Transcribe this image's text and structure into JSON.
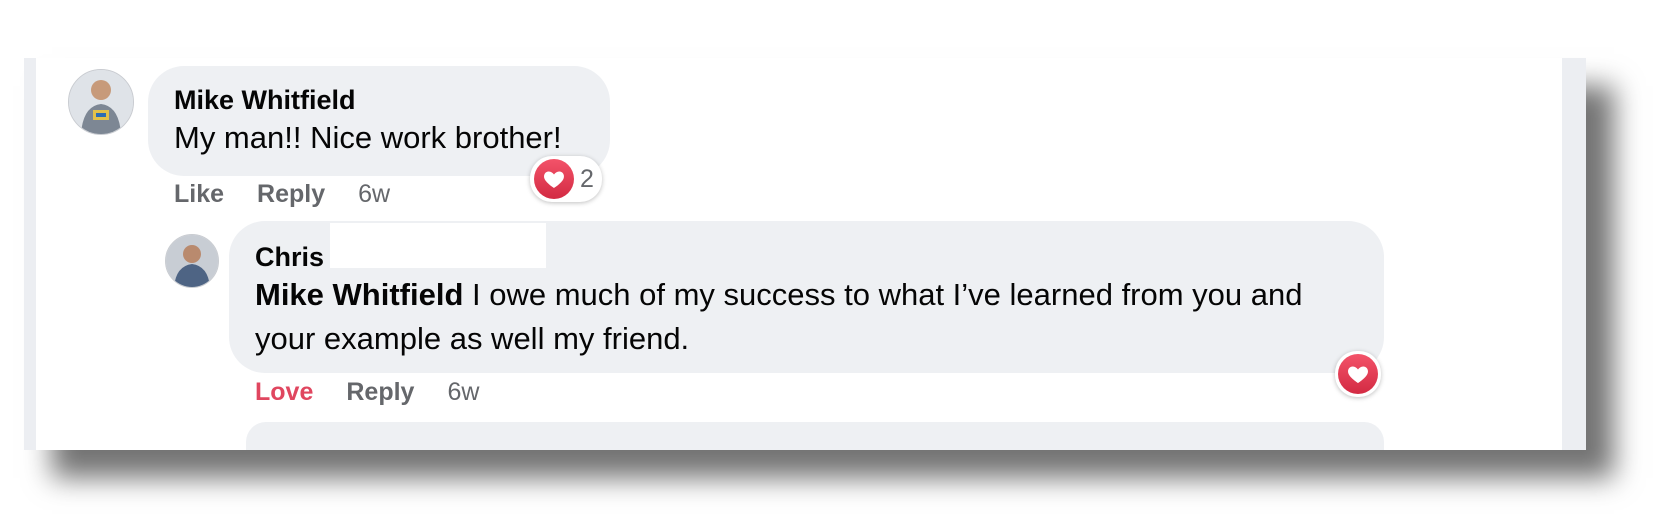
{
  "comments": [
    {
      "author": "Mike Whitfield",
      "text": "My man!! Nice work brother!",
      "reaction_count": "2",
      "reaction_icon": "heart-icon",
      "actions": {
        "like": "Like",
        "reply": "Reply",
        "time": "6w"
      }
    }
  ],
  "reply": {
    "author": "Chris",
    "mention": "Mike Whitfield",
    "text": " I owe much of my success to what I’ve learned from you and your example as well my friend.",
    "reaction_icon": "heart-icon",
    "actions": {
      "love": "Love",
      "reply": "Reply",
      "time": "6w"
    }
  },
  "colors": {
    "bubble": "#eef0f3",
    "love_red": "#e0465f",
    "muted_text": "#65676b"
  }
}
